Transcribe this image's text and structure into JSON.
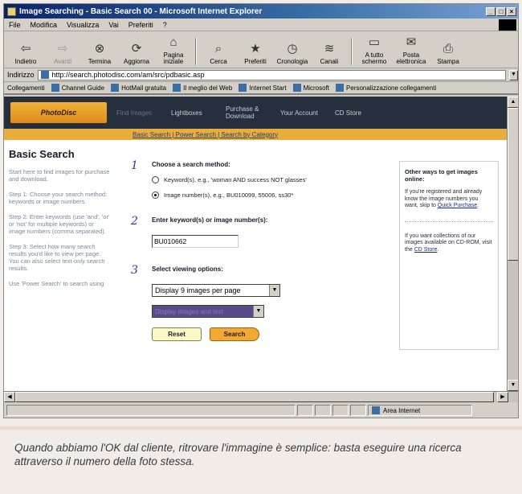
{
  "window": {
    "title": "Image Searching - Basic Search 00 - Microsoft Internet Explorer",
    "buttons": [
      "_",
      "□",
      "×"
    ]
  },
  "menu": [
    "File",
    "Modifica",
    "Visualizza",
    "Vai",
    "Preferiti",
    "?"
  ],
  "toolbar": [
    {
      "label": "Indietro",
      "icon": "⇦",
      "enabled": true
    },
    {
      "label": "Avanti",
      "icon": "⇨",
      "enabled": false
    },
    {
      "label": "Termina",
      "icon": "⊗",
      "enabled": true
    },
    {
      "label": "Aggiorna",
      "icon": "⟳",
      "enabled": true
    },
    {
      "label": "Pagina iniziale",
      "icon": "⌂",
      "enabled": true
    },
    {
      "label": "Cerca",
      "icon": "⌕",
      "enabled": true
    },
    {
      "label": "Preferiti",
      "icon": "★",
      "enabled": true
    },
    {
      "label": "Cronologia",
      "icon": "◷",
      "enabled": true
    },
    {
      "label": "Canali",
      "icon": "≋",
      "enabled": true
    },
    {
      "label": "A tutto schermo",
      "icon": "▭",
      "enabled": true
    },
    {
      "label": "Posta elettronica",
      "icon": "✉",
      "enabled": true
    },
    {
      "label": "Stampa",
      "icon": "⎙",
      "enabled": true
    }
  ],
  "address": {
    "label": "Indirizzo",
    "url": "http://search.photodisc.com/am/src/pdbasic.asp"
  },
  "links": {
    "label": "Collegamenti",
    "items": [
      "Channel Guide",
      "HotMail gratuita",
      "Il meglio del Web",
      "Internet Start",
      "Microsoft",
      "Personalizzazione collegamenti"
    ]
  },
  "site": {
    "logo": "PhotoDisc",
    "nav": [
      {
        "label": "Find Images",
        "active": true
      },
      {
        "label": "Lightboxes",
        "active": false
      },
      {
        "label": "Purchase & Download",
        "active": false
      },
      {
        "label": "Your Account",
        "active": false
      },
      {
        "label": "CD Store",
        "active": false
      }
    ],
    "subnav": "Basic Search | Power Search | Search by Category"
  },
  "left": {
    "title": "Basic Search",
    "paragraphs": [
      "Start here to find images for purchase and download.",
      "Step 1: Choose your search method: keywords or image numbers.",
      "Step 2: Enter keywords (use 'and', 'or' or 'not' for multiple keywords) or image numbers (comma separated).",
      "Step 3: Select how many search results you'd like to view per page. You can also select text-only search results.",
      "Use 'Power Search' to search using"
    ]
  },
  "form": {
    "step1": {
      "num": "1",
      "label": "Choose a search method:",
      "opt1": "Keyword(s), e.g., 'woman AND success NOT glasses'",
      "opt2": "Image number(s), e.g., BU010099, 55006, ss30*"
    },
    "step2": {
      "num": "2",
      "label": "Enter keyword(s) or image number(s):",
      "value": "BU010662"
    },
    "step3": {
      "num": "3",
      "label": "Select viewing options:",
      "per_page": "Display 9 images per page",
      "display_mode": "Display images and text"
    },
    "reset": "Reset",
    "search": "Search"
  },
  "sidebar": {
    "title": "Other ways to get images online:",
    "text1": "If you're registered and already know the image numbers you want, skip to",
    "link1": "Quick Purchase",
    "text2": "If you want collections of our images available on CD-ROM, visit the",
    "link2": "CD Store"
  },
  "status": {
    "zone": "Area Internet"
  },
  "caption": "Quando abbiamo l'OK dal cliente, ritrovare l'immagine è semplice: basta eseguire una ricerca attraverso il numero della foto stessa."
}
